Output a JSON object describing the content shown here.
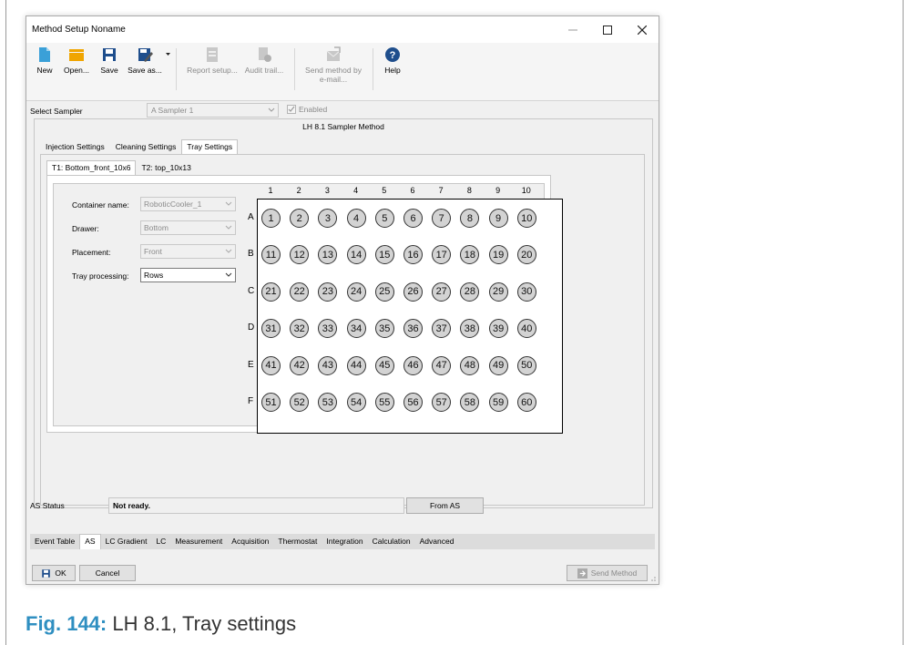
{
  "window": {
    "title": "Method Setup Noname"
  },
  "toolbar": {
    "new": "New",
    "open": "Open...",
    "save": "Save",
    "save_as": "Save as...",
    "report_setup": "Report setup...",
    "audit_trail": "Audit trail...",
    "send_email_line1": "Send method by",
    "send_email_line2": "e-mail...",
    "help": "Help"
  },
  "sampler": {
    "label": "Select Sampler",
    "value": "A Sampler 1",
    "enabled_label": "Enabled",
    "enabled": true
  },
  "method_title": "LH 8.1 Sampler Method",
  "settings_tabs": [
    "Injection Settings",
    "Cleaning Settings",
    "Tray Settings"
  ],
  "tray_tabs": [
    "T1: Bottom_front_10x6",
    "T2: top_10x13"
  ],
  "form": {
    "container_label": "Container name:",
    "container_value": "RoboticCooler_1",
    "drawer_label": "Drawer:",
    "drawer_value": "Bottom",
    "placement_label": "Placement:",
    "placement_value": "Front",
    "processing_label": "Tray processing:",
    "processing_value": "Rows"
  },
  "tray": {
    "columns": [
      "1",
      "2",
      "3",
      "4",
      "5",
      "6",
      "7",
      "8",
      "9",
      "10"
    ],
    "rows": [
      "A",
      "B",
      "C",
      "D",
      "E",
      "F"
    ],
    "wells": [
      [
        "1",
        "2",
        "3",
        "4",
        "5",
        "6",
        "7",
        "8",
        "9",
        "10"
      ],
      [
        "11",
        "12",
        "13",
        "14",
        "15",
        "16",
        "17",
        "18",
        "19",
        "20"
      ],
      [
        "21",
        "22",
        "23",
        "24",
        "25",
        "26",
        "27",
        "28",
        "29",
        "30"
      ],
      [
        "31",
        "32",
        "33",
        "34",
        "35",
        "36",
        "37",
        "38",
        "39",
        "40"
      ],
      [
        "41",
        "42",
        "43",
        "44",
        "45",
        "46",
        "47",
        "48",
        "49",
        "50"
      ],
      [
        "51",
        "52",
        "53",
        "54",
        "55",
        "56",
        "57",
        "58",
        "59",
        "60"
      ]
    ]
  },
  "status": {
    "label": "AS Status",
    "value": "Not ready.",
    "from_as": "From AS"
  },
  "bottom_tabs": [
    "Event Table",
    "AS",
    "LC Gradient",
    "LC",
    "Measurement",
    "Acquisition",
    "Thermostat",
    "Integration",
    "Calculation",
    "Advanced"
  ],
  "footer": {
    "ok": "OK",
    "cancel": "Cancel",
    "send_method": "Send Method"
  },
  "caption": {
    "fig": "Fig. 144:",
    "text": "LH 8.1, Tray settings"
  },
  "colors": {
    "accent": "#2f8fc1",
    "toolbar_blue": "#1f4e8c",
    "folder": "#f0a500",
    "well_fill": "#d3d3d3"
  }
}
